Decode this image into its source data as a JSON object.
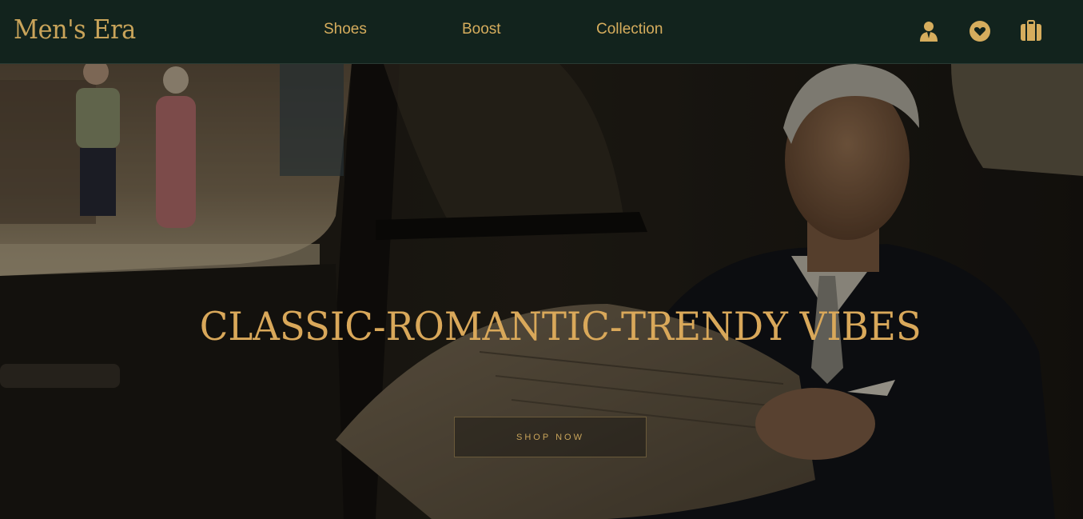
{
  "brand": {
    "logo": "Men's Era",
    "accent_color": "#d6ad5d",
    "nav_bg": "#12231d"
  },
  "nav": {
    "links": [
      {
        "label": "Shoes"
      },
      {
        "label": "Boost"
      },
      {
        "label": "Collection"
      }
    ],
    "icons": [
      "user-icon",
      "heart-icon",
      "shopping-bag-icon"
    ]
  },
  "hero": {
    "title": "CLASSIC-ROMANTIC-TRENDY VIBES",
    "cta_label": "SHOP NOW",
    "background_image": "man-in-suit-reading-newspaper-in-car-photo"
  }
}
